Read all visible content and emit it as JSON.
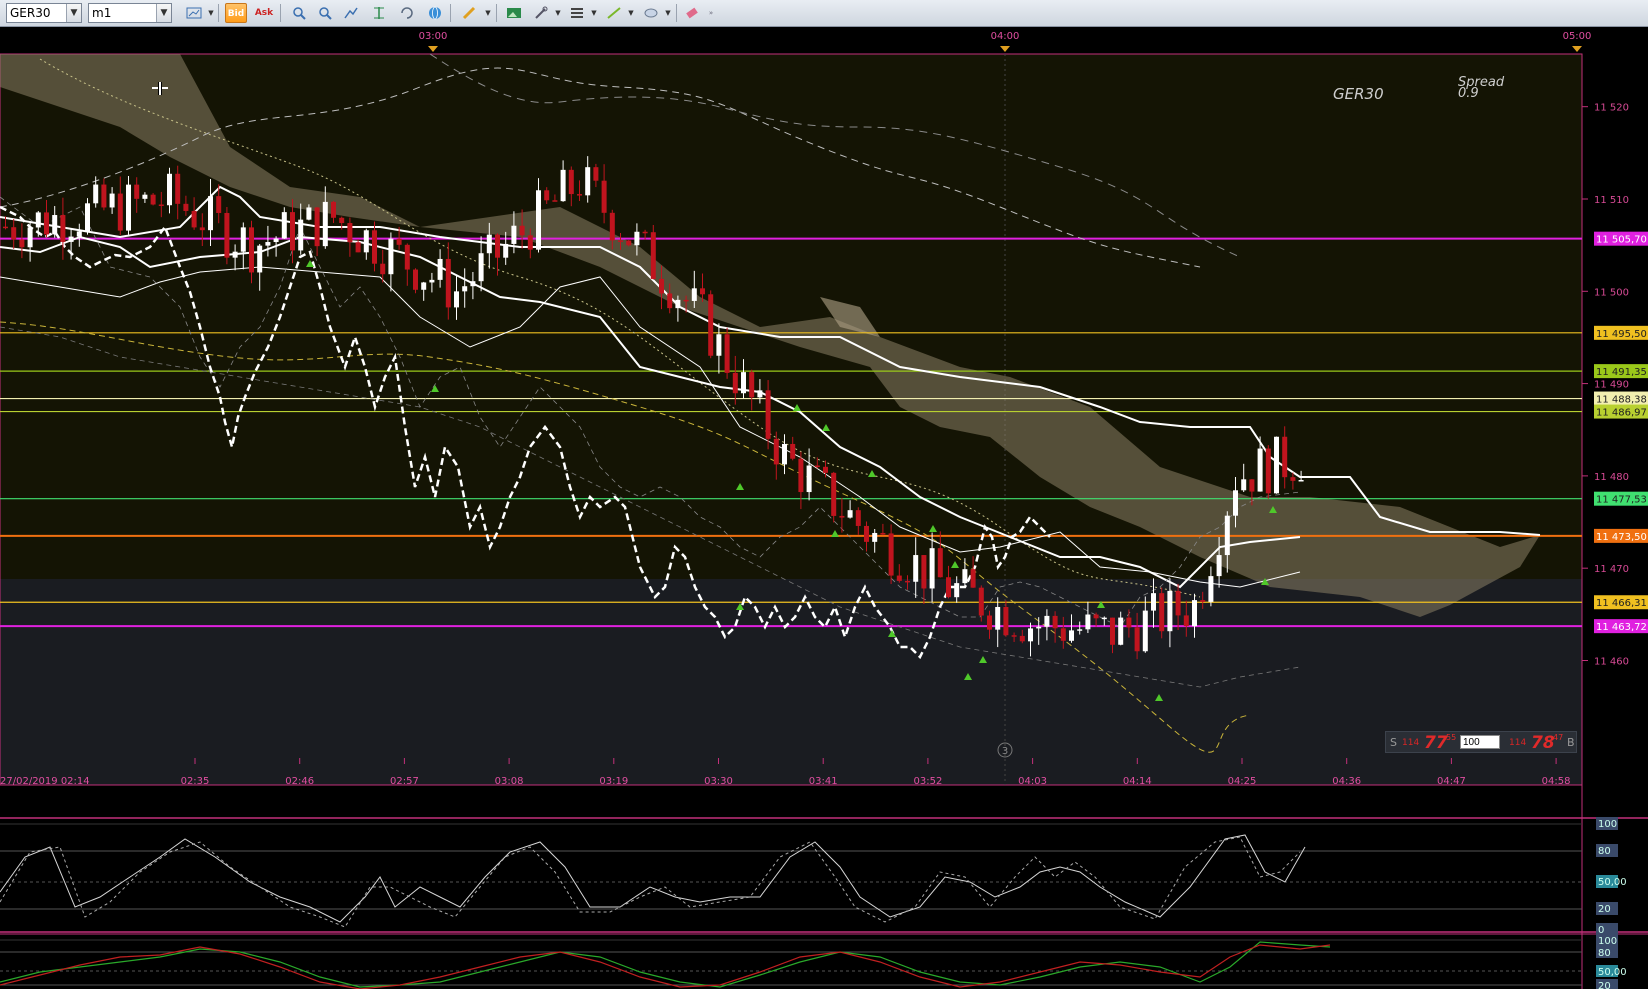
{
  "toolbar": {
    "symbol": "GER30",
    "timeframe": "m1",
    "bid_label": "Bid",
    "ask_label": "Ask"
  },
  "chart_data": {
    "type": "candlestick",
    "instrument": "GER30",
    "watermark_symbol": "GER30",
    "spread_label": "Spread",
    "spread_value": "0.9",
    "top_time_labels": [
      "03:00",
      "04:00",
      "05:00"
    ],
    "bottom_time_labels": [
      "27/02/2019 02:14",
      "02:35",
      "02:46",
      "02:57",
      "03:08",
      "03:19",
      "03:30",
      "03:41",
      "03:52",
      "04:03",
      "04:14",
      "04:25",
      "04:36",
      "04:47",
      "04:58"
    ],
    "price_ticks": [
      "11 520",
      "11 510",
      "11 500",
      "11 490",
      "11 480",
      "11 470",
      "11 460"
    ],
    "ylim": [
      11452,
      11523
    ],
    "level_tags": [
      {
        "text": "11 505,70",
        "price": 11505.7,
        "color": "#e020e0"
      },
      {
        "text": "11 495,50",
        "price": 11495.5,
        "color": "#f0c020"
      },
      {
        "text": "11 491,35",
        "price": 11491.35,
        "color": "#9ac81a"
      },
      {
        "text": "11 488,38",
        "price": 11488.38,
        "color": "#f2efb0"
      },
      {
        "text": "11 486,97",
        "price": 11486.97,
        "color": "#b8d030"
      },
      {
        "text": "11 477,53",
        "price": 11477.53,
        "color": "#40e070"
      },
      {
        "text": "11 473,50",
        "price": 11473.5,
        "color": "#f07010"
      },
      {
        "text": "11 466,31",
        "price": 11466.31,
        "color": "#f0c020"
      },
      {
        "text": "11 463,72",
        "price": 11463.72,
        "color": "#e020e0"
      }
    ],
    "osc1_levels": [
      "100",
      "80",
      "50,00",
      "20",
      "0"
    ],
    "osc2_levels": [
      "100",
      "80",
      "50,00",
      "20"
    ],
    "osc_marker": "3"
  },
  "trade": {
    "sell_label": "S",
    "sell_small": "114",
    "sell_big": "77",
    "sell_sup": "55",
    "amount": "100",
    "buy_small": "114",
    "buy_big": "78",
    "buy_sup": "47",
    "buy_label": "B"
  },
  "colors": {
    "candle_up": "#ffffff",
    "candle_down": "#c0141e",
    "axis": "#e04ea0",
    "background_upper": "#141404",
    "background_lower": "#1a1c21"
  }
}
